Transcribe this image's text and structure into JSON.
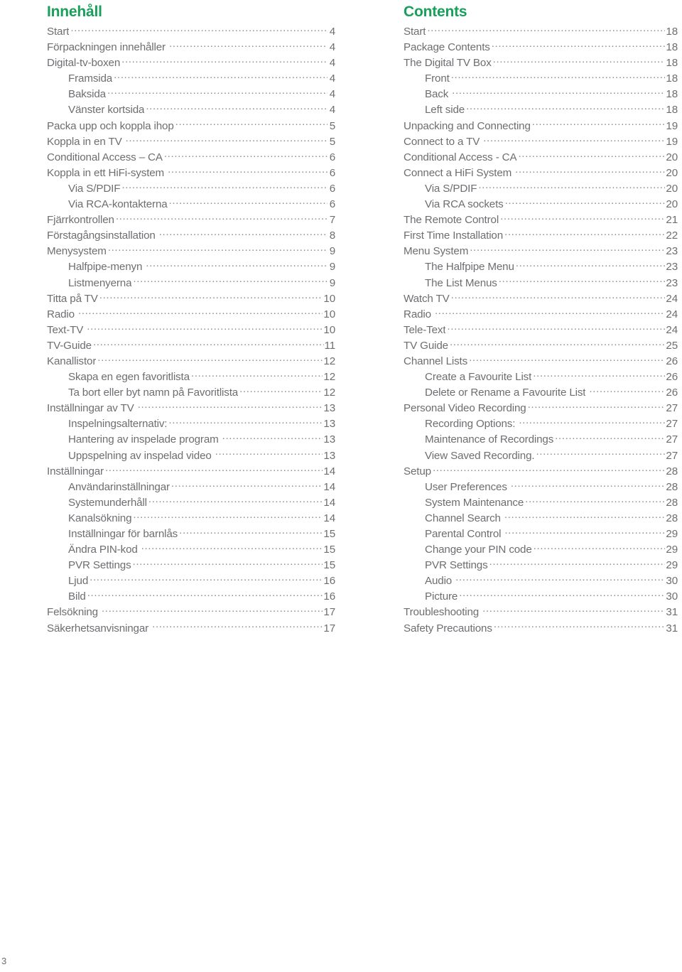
{
  "document": {
    "folio": "3",
    "accent_color": "#18a05a",
    "text_color": "#6e6e72"
  },
  "columns": [
    {
      "id": "swedish",
      "title": "Innehåll",
      "entries": [
        {
          "label": "Start",
          "page": "4",
          "level": 1
        },
        {
          "label": "Förpackningen innehåller",
          "page": "4",
          "level": 1,
          "gap": true
        },
        {
          "label": "Digital-tv-boxen",
          "page": "4",
          "level": 1
        },
        {
          "label": "Framsida",
          "page": "4",
          "level": 2
        },
        {
          "label": "Baksida",
          "page": "4",
          "level": 2
        },
        {
          "label": "Vänster kortsida",
          "page": "4",
          "level": 2
        },
        {
          "label": "Packa upp och koppla ihop",
          "page": "5",
          "level": 1
        },
        {
          "label": "Koppla in en TV",
          "page": "5",
          "level": 1,
          "gap": true
        },
        {
          "label": "Conditional Access – CA",
          "page": "6",
          "level": 1
        },
        {
          "label": "Koppla in ett HiFi-system",
          "page": "6",
          "level": 1,
          "gap": true
        },
        {
          "label": "Via S/PDIF",
          "page": "6",
          "level": 2
        },
        {
          "label": "Via RCA-kontakterna",
          "page": "6",
          "level": 2
        },
        {
          "label": "Fjärrkontrollen",
          "page": "7",
          "level": 1
        },
        {
          "label": "Förstagångsinstallation",
          "page": "8",
          "level": 1,
          "gap": true
        },
        {
          "label": "Menysystem",
          "page": "9",
          "level": 1
        },
        {
          "label": "Halfpipe-menyn",
          "page": "9",
          "level": 2,
          "gap": true
        },
        {
          "label": "Listmenyerna",
          "page": "9",
          "level": 2
        },
        {
          "label": "Titta på TV",
          "page": "10",
          "level": 1
        },
        {
          "label": "Radio",
          "page": "10",
          "level": 1,
          "gap": true
        },
        {
          "label": "Text-TV",
          "page": "10",
          "level": 1,
          "gap": true
        },
        {
          "label": "TV-Guide",
          "page": "11",
          "level": 1
        },
        {
          "label": "Kanallistor",
          "page": "12",
          "level": 1
        },
        {
          "label": "Skapa en egen favoritlista",
          "page": "12",
          "level": 2
        },
        {
          "label": "Ta bort eller byt namn på Favoritlista",
          "page": "12",
          "level": 2
        },
        {
          "label": "Inställningar av TV",
          "page": "13",
          "level": 1,
          "gap": true
        },
        {
          "label": "Inspelningsalternativ:",
          "page": "13",
          "level": 2
        },
        {
          "label": "Hantering av inspelade program",
          "page": "13",
          "level": 2,
          "gap": true
        },
        {
          "label": "Uppspelning av inspelad video",
          "page": "13",
          "level": 2,
          "gap": true
        },
        {
          "label": "Inställningar",
          "page": "14",
          "level": 1
        },
        {
          "label": "Användarinställningar",
          "page": "14",
          "level": 2
        },
        {
          "label": "Systemunderhåll",
          "page": "14",
          "level": 2
        },
        {
          "label": "Kanalsökning",
          "page": "14",
          "level": 2
        },
        {
          "label": "Inställningar för barnlås",
          "page": "15",
          "level": 2
        },
        {
          "label": "Ändra PIN-kod",
          "page": "15",
          "level": 2,
          "gap": true
        },
        {
          "label": "PVR Settings",
          "page": "15",
          "level": 2
        },
        {
          "label": "Ljud",
          "page": "16",
          "level": 2
        },
        {
          "label": "Bild",
          "page": "16",
          "level": 2
        },
        {
          "label": "Felsökning",
          "page": "17",
          "level": 1,
          "gap": true
        },
        {
          "label": "Säkerhetsanvisningar",
          "page": "17",
          "level": 1,
          "gap": true
        }
      ]
    },
    {
      "id": "english",
      "title": "Contents",
      "entries": [
        {
          "label": "Start",
          "page": "18",
          "level": 1
        },
        {
          "label": "Package Contents",
          "page": "18",
          "level": 1
        },
        {
          "label": "The Digital TV Box",
          "page": "18",
          "level": 1
        },
        {
          "label": "Front",
          "page": "18",
          "level": 2
        },
        {
          "label": "Back",
          "page": "18",
          "level": 2,
          "gap": true
        },
        {
          "label": "Left side",
          "page": "18",
          "level": 2
        },
        {
          "label": "Unpacking and Connecting",
          "page": "19",
          "level": 1
        },
        {
          "label": "Connect to a TV",
          "page": "19",
          "level": 1,
          "gap": true
        },
        {
          "label": "Conditional Access - CA",
          "page": "20",
          "level": 1
        },
        {
          "label": "Connect a HiFi System",
          "page": "20",
          "level": 1,
          "gap": true
        },
        {
          "label": "Via S/PDIF",
          "page": "20",
          "level": 2
        },
        {
          "label": "Via RCA sockets",
          "page": "20",
          "level": 2
        },
        {
          "label": "The Remote Control",
          "page": "21",
          "level": 1
        },
        {
          "label": "First Time Installation",
          "page": "22",
          "level": 1
        },
        {
          "label": "Menu System",
          "page": "23",
          "level": 1
        },
        {
          "label": "The Halfpipe Menu",
          "page": "23",
          "level": 2
        },
        {
          "label": "The List Menus",
          "page": "23",
          "level": 2
        },
        {
          "label": "Watch TV",
          "page": "24",
          "level": 1
        },
        {
          "label": "Radio",
          "page": "24",
          "level": 1,
          "gap": true
        },
        {
          "label": "Tele-Text",
          "page": "24",
          "level": 1
        },
        {
          "label": "TV Guide",
          "page": "25",
          "level": 1
        },
        {
          "label": "Channel Lists",
          "page": "26",
          "level": 1
        },
        {
          "label": "Create a Favourite List",
          "page": "26",
          "level": 2
        },
        {
          "label": "Delete or Rename a Favourite List",
          "page": "26",
          "level": 2,
          "gap": true
        },
        {
          "label": "Personal Video Recording",
          "page": "27",
          "level": 1
        },
        {
          "label": "Recording Options:",
          "page": "27",
          "level": 2,
          "gap": true
        },
        {
          "label": "Maintenance of Recordings",
          "page": "27",
          "level": 2
        },
        {
          "label": "View Saved Recording.",
          "page": "27",
          "level": 2
        },
        {
          "label": "Setup",
          "page": "28",
          "level": 1
        },
        {
          "label": "User Preferences",
          "page": "28",
          "level": 2,
          "gap": true
        },
        {
          "label": "System Maintenance",
          "page": "28",
          "level": 2
        },
        {
          "label": "Channel Search",
          "page": "28",
          "level": 2,
          "gap": true
        },
        {
          "label": "Parental Control",
          "page": "29",
          "level": 2,
          "gap": true
        },
        {
          "label": "Change your PIN code",
          "page": "29",
          "level": 2
        },
        {
          "label": "PVR Settings",
          "page": "29",
          "level": 2
        },
        {
          "label": "Audio",
          "page": "30",
          "level": 2,
          "gap": true
        },
        {
          "label": "Picture",
          "page": "30",
          "level": 2
        },
        {
          "label": "Troubleshooting",
          "page": "31",
          "level": 1,
          "gap": true
        },
        {
          "label": "Safety Precautions",
          "page": "31",
          "level": 1
        }
      ]
    }
  ]
}
